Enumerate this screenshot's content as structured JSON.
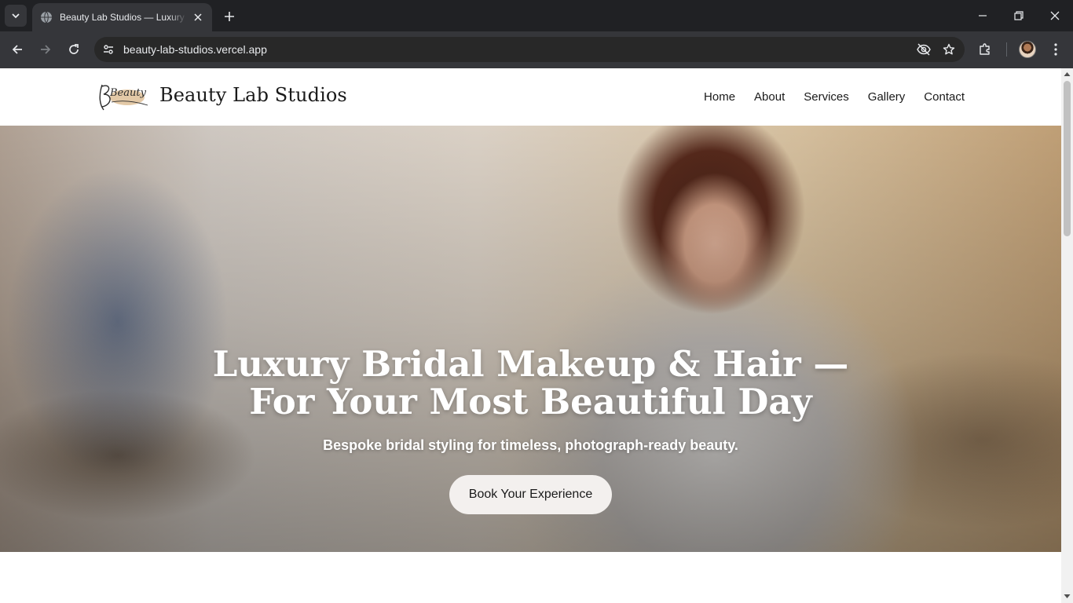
{
  "browser": {
    "tab_title": "Beauty Lab Studios — Luxury Bridal Makeup & Hair",
    "url": "beauty-lab-studios.vercel.app"
  },
  "site": {
    "brand": "Beauty Lab Studios",
    "logo_text": "Beauty",
    "nav": [
      "Home",
      "About",
      "Services",
      "Gallery",
      "Contact"
    ]
  },
  "hero": {
    "title_line1": "Luxury Bridal Makeup & Hair —",
    "title_line2": "For Your Most Beautiful Day",
    "subtitle": "Bespoke bridal styling for timeless, photograph-ready beauty.",
    "cta": "Book Your Experience"
  },
  "colors": {
    "chrome_bg": "#202124",
    "toolbar_bg": "#35363a",
    "cta_bg": "#f3f0ee"
  }
}
